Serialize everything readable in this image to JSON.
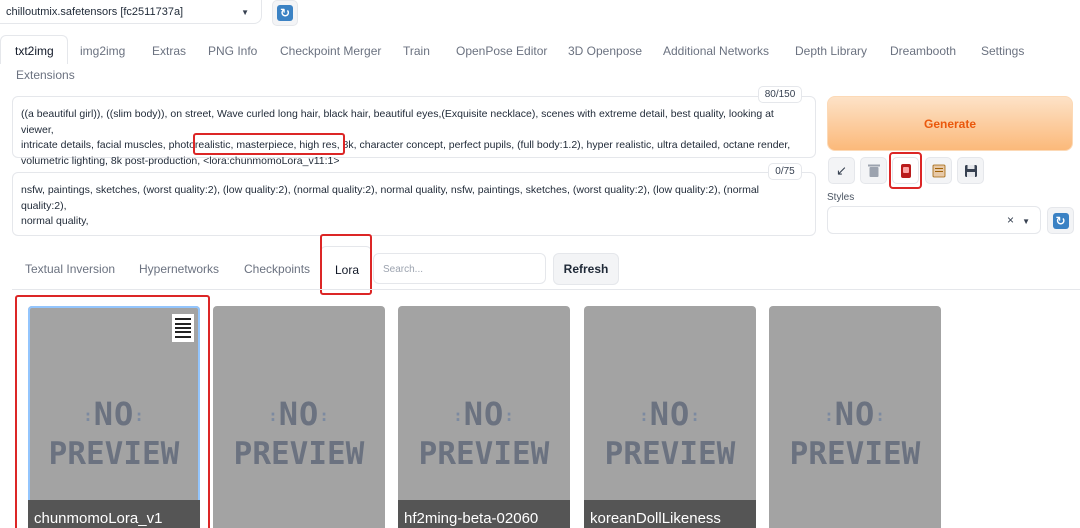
{
  "header": {
    "checkpoint_value": "chilloutmix.safetensors [fc2511737a]"
  },
  "tabs": [
    "txt2img",
    "img2img",
    "Extras",
    "PNG Info",
    "Checkpoint Merger",
    "Train",
    "OpenPose Editor",
    "3D Openpose",
    "Additional Networks",
    "Depth Library",
    "Dreambooth",
    "Settings",
    "Extensions"
  ],
  "prompt": {
    "counter": "80/150",
    "line1": "((a beautiful girl)), ((slim body)), on street, Wave curled long hair, black hair, beautiful eyes,(Exquisite necklace), scenes with extreme detail, best quality, looking at viewer,",
    "line2": "intricate details,  facial muscles, photorealistic, masterpiece, high res, 8k, character concept,  perfect pupils, (full body:1.2), hyper realistic, ultra detailed, octane render,",
    "line3": "volumetric lighting, 8k post-production,",
    "lora_tag": "<lora:chunmomoLora_v11:1>"
  },
  "negative_prompt": {
    "counter": "0/75",
    "line1": "nsfw, paintings, sketches, (worst quality:2), (low quality:2), (normal quality:2), normal quality, nsfw, paintings, sketches, (worst quality:2), (low quality:2), (normal quality:2),",
    "line2": "normal quality,"
  },
  "generate_label": "Generate",
  "styles_label": "Styles",
  "styles_clear": "×",
  "network_tabs": [
    "Textual Inversion",
    "Hypernetworks",
    "Checkpoints",
    "Lora"
  ],
  "search_placeholder": "Search...",
  "refresh_label": "Refresh",
  "cards": [
    {
      "name": "chunmomoLora_v1",
      "preview_line1": "NO",
      "preview_line2": "PREVIEW"
    },
    {
      "name": "",
      "preview_line1": "NO",
      "preview_line2": "PREVIEW"
    },
    {
      "name": "hf2ming-beta-02060",
      "preview_line1": "NO",
      "preview_line2": "PREVIEW"
    },
    {
      "name": "koreanDollLikeness",
      "preview_line1": "NO",
      "preview_line2": "PREVIEW"
    },
    {
      "name": "",
      "preview_line1": "NO",
      "preview_line2": "PREVIEW"
    }
  ],
  "colors": {
    "accent_orange": "#ea580c",
    "highlight_red": "#dc2626",
    "card_gray": "#a3a3a3"
  }
}
